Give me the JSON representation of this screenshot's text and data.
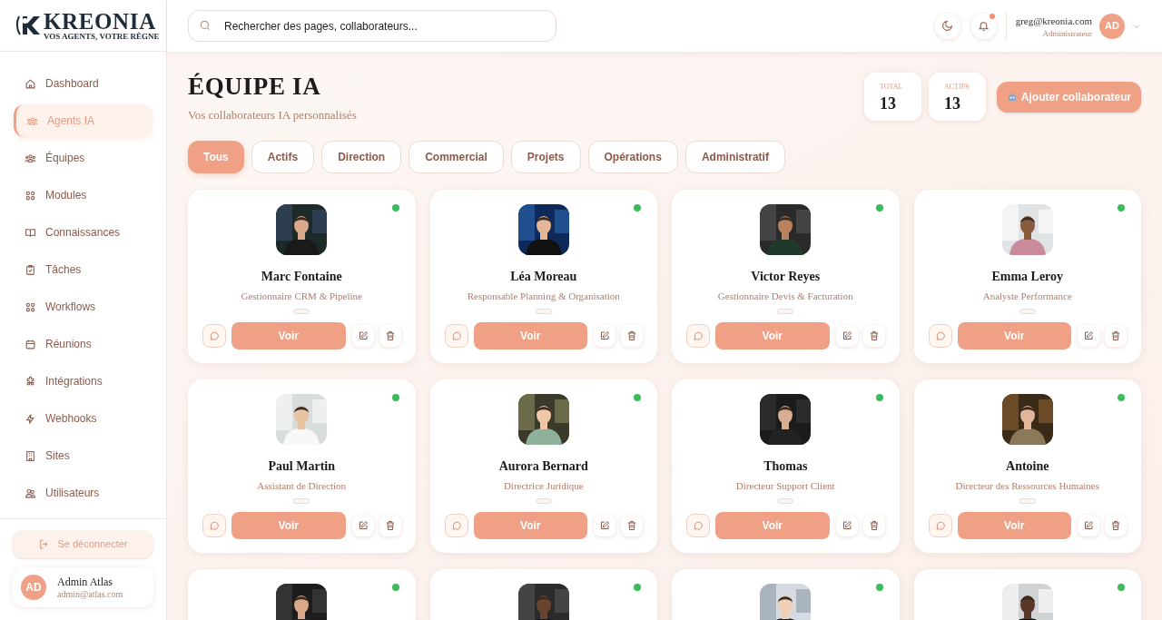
{
  "brand": {
    "name": "KREONIA",
    "tagline": "VOS AGENTS, VOTRE RÈGNE"
  },
  "search": {
    "placeholder": "Rechercher des pages, collaborateurs..."
  },
  "header": {
    "notifications_unread": true,
    "user": {
      "email": "greg@kreonia.com",
      "role": "Administrateur",
      "initials": "AD"
    }
  },
  "sidebar": {
    "items": [
      {
        "label": "Dashboard",
        "kind": "home",
        "selected": false
      },
      {
        "label": "Agents IA",
        "kind": "users",
        "selected": true
      },
      {
        "label": "Équipes",
        "kind": "users",
        "selected": false
      },
      {
        "label": "Modules",
        "kind": "grid",
        "selected": false
      },
      {
        "label": "Connaissances",
        "kind": "book",
        "selected": false
      },
      {
        "label": "Tâches",
        "kind": "clipboard",
        "selected": false
      },
      {
        "label": "Workflows",
        "kind": "grid",
        "selected": false
      },
      {
        "label": "Réunions",
        "kind": "calendar",
        "selected": false
      },
      {
        "label": "Intégrations",
        "kind": "puzzle",
        "selected": false
      },
      {
        "label": "Webhooks",
        "kind": "bolt",
        "selected": false
      },
      {
        "label": "Sites",
        "kind": "building",
        "selected": false
      },
      {
        "label": "Utilisateurs",
        "kind": "people",
        "selected": false
      }
    ],
    "logout": "Se déconnecter",
    "account": {
      "initials": "AD",
      "name": "Admin Atlas",
      "email": "admin@atlas.com"
    }
  },
  "page": {
    "title": "ÉQUIPE IA",
    "subtitle": "Vos collaborateurs IA personnalisés",
    "stats": [
      {
        "label": "TOTAL",
        "value": "13"
      },
      {
        "label": "ACTIFS",
        "value": "13"
      }
    ],
    "add_button": "Ajouter collaborateur"
  },
  "filters": [
    {
      "label": "Tous",
      "selected": true
    },
    {
      "label": "Actifs",
      "selected": false
    },
    {
      "label": "Direction",
      "selected": false
    },
    {
      "label": "Commercial",
      "selected": false
    },
    {
      "label": "Projets",
      "selected": false
    },
    {
      "label": "Opérations",
      "selected": false
    },
    {
      "label": "Administratif",
      "selected": false
    }
  ],
  "agents": [
    {
      "name": "Marc Fontaine",
      "role": "Gestionnaire CRM & Pipeline",
      "online": true,
      "action": "Voir"
    },
    {
      "name": "Léa Moreau",
      "role": "Responsable Planning & Organisation",
      "online": true,
      "action": "Voir"
    },
    {
      "name": "Victor Reyes",
      "role": "Gestionnaire Devis & Facturation",
      "online": true,
      "action": "Voir"
    },
    {
      "name": "Emma Leroy",
      "role": "Analyste Performance",
      "online": true,
      "action": "Voir"
    },
    {
      "name": "Paul Martin",
      "role": "Assistant de Direction",
      "online": true,
      "action": "Voir"
    },
    {
      "name": "Aurora Bernard",
      "role": "Directrice Juridique",
      "online": true,
      "action": "Voir"
    },
    {
      "name": "Thomas",
      "role": "Directeur Support Client",
      "online": true,
      "action": "Voir"
    },
    {
      "name": "Antoine",
      "role": "Directeur des Ressources Humaines",
      "online": true,
      "action": "Voir"
    },
    {
      "online": true
    },
    {
      "online": true
    },
    {
      "online": true
    },
    {
      "online": true
    }
  ]
}
